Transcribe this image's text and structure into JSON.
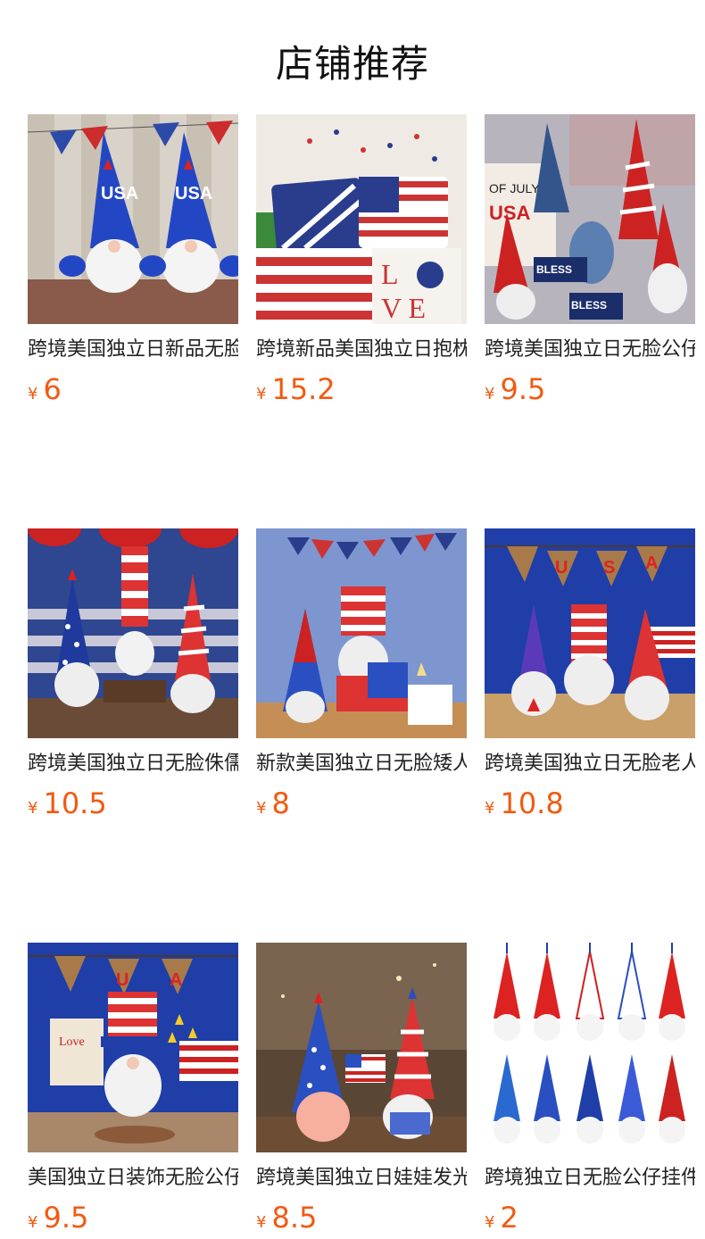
{
  "section": {
    "title": "店铺推荐"
  },
  "products": [
    {
      "name": "跨境美国独立日新品无脸公仔",
      "currency": "¥",
      "price": "6",
      "image": "two-blue-usa-gnomes-with-bunting"
    },
    {
      "name": "跨境新品美国独立日抱枕套",
      "currency": "¥",
      "price": "15.2",
      "image": "flag-and-love-pillows"
    },
    {
      "name": "跨境美国独立日无脸公仔装饰",
      "currency": "¥",
      "price": "9.5",
      "image": "patriotic-gnome-group-god-bless-america"
    },
    {
      "name": "跨境美国独立日无脸侏儒娃娃",
      "currency": "¥",
      "price": "10.5",
      "image": "three-striped-hat-gnomes-on-books"
    },
    {
      "name": "新款美国独立日无脸矮人摆件",
      "currency": "¥",
      "price": "8",
      "image": "gnomes-with-gift-boxes-and-bunting"
    },
    {
      "name": "跨境美国独立日无脸老人玩偶",
      "currency": "¥",
      "price": "10.8",
      "image": "gnome-trio-with-usa-banner"
    },
    {
      "name": "美国独立日装饰无脸公仔摆件",
      "currency": "¥",
      "price": "9.5",
      "image": "top-hat-gnome-with-stars"
    },
    {
      "name": "跨境美国独立日娃娃发光摆件",
      "currency": "¥",
      "price": "8.5",
      "image": "glowing-gnome-pair-with-flag"
    },
    {
      "name": "跨境独立日无脸公仔挂件",
      "currency": "¥",
      "price": "2",
      "image": "ten-hanging-gnome-ornaments"
    }
  ]
}
